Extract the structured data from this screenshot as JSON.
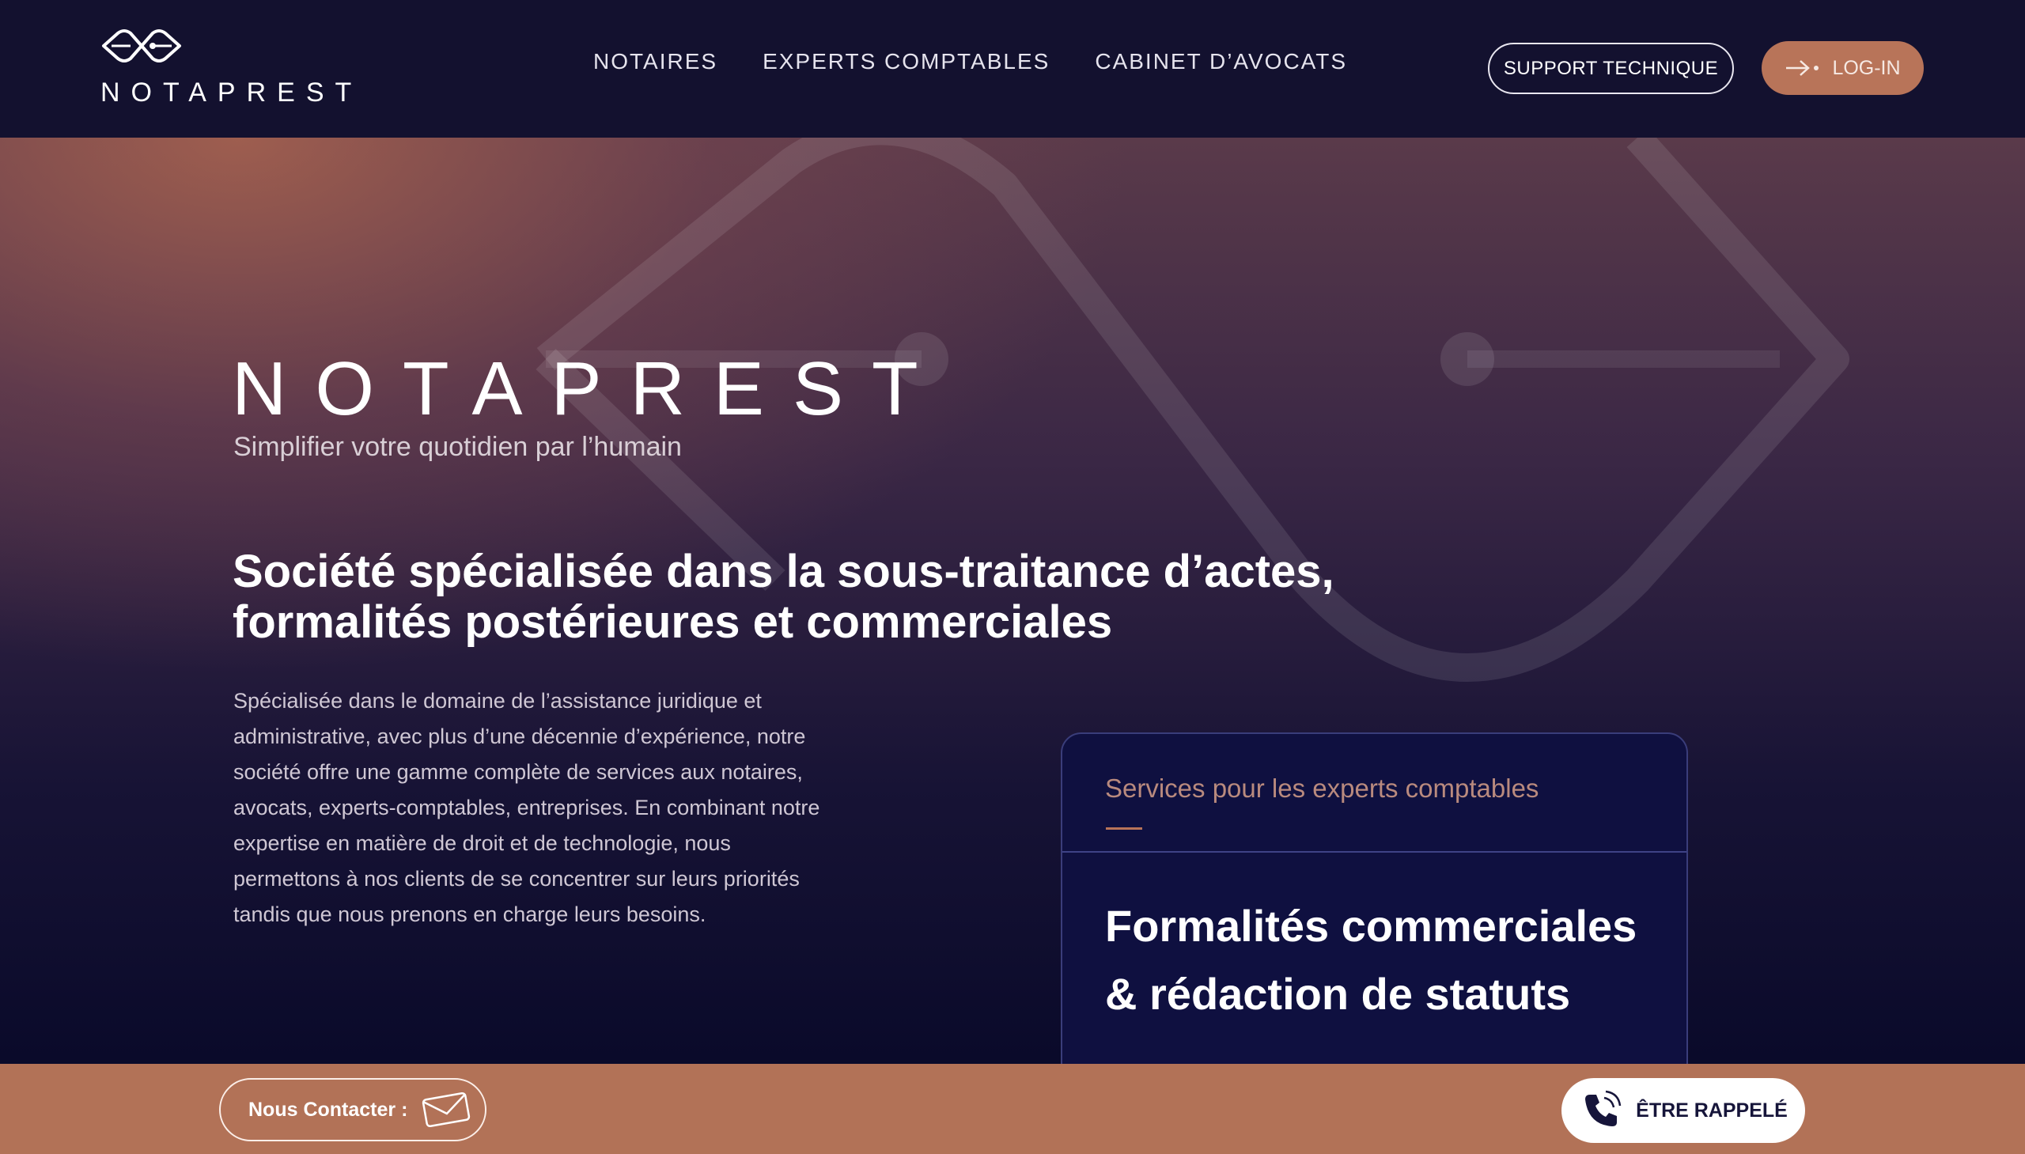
{
  "header": {
    "logo_text": "NOTAPREST",
    "nav": [
      {
        "label": "NOTAIRES"
      },
      {
        "label": "EXPERTS COMPTABLES"
      },
      {
        "label": "CABINET D’AVOCATS"
      }
    ],
    "support_label": "SUPPORT TECHNIQUE",
    "login_label": "LOG-IN"
  },
  "hero": {
    "brand": "NOTAPREST",
    "tagline": "Simplifier votre quotidien par l’humain",
    "title": "Société spécialisée dans la sous-traitance d’actes, formalités postérieures et commerciales",
    "description": "Spécialisée dans le domaine de l’assistance juridique et administrative, avec plus d’une décennie d’expérience, notre société offre une gamme complète de services aux notaires, avocats, experts-comptables, entreprises. En combinant notre expertise en matière de droit et de technologie, nous permettons à nos clients de se concentrer sur leurs priorités tandis que nous prenons en charge leurs besoins."
  },
  "service_card": {
    "label": "Services pour les experts comptables",
    "title": "Formalités commerciales & rédaction de statuts"
  },
  "bottom_bar": {
    "contact_label": "Nous Contacter :",
    "callback_label": "ÊTRE RAPPELÉ"
  },
  "icons": {
    "logo": "notaprest-logo-icon",
    "login": "login-arrow-icon",
    "contact": "envelope-icon",
    "callback": "phone-icon"
  },
  "colors": {
    "header_bg": "#13112f",
    "accent": "#b87459",
    "card_bg": "#0f1040",
    "bottom_bar_bg": "#b27257"
  }
}
